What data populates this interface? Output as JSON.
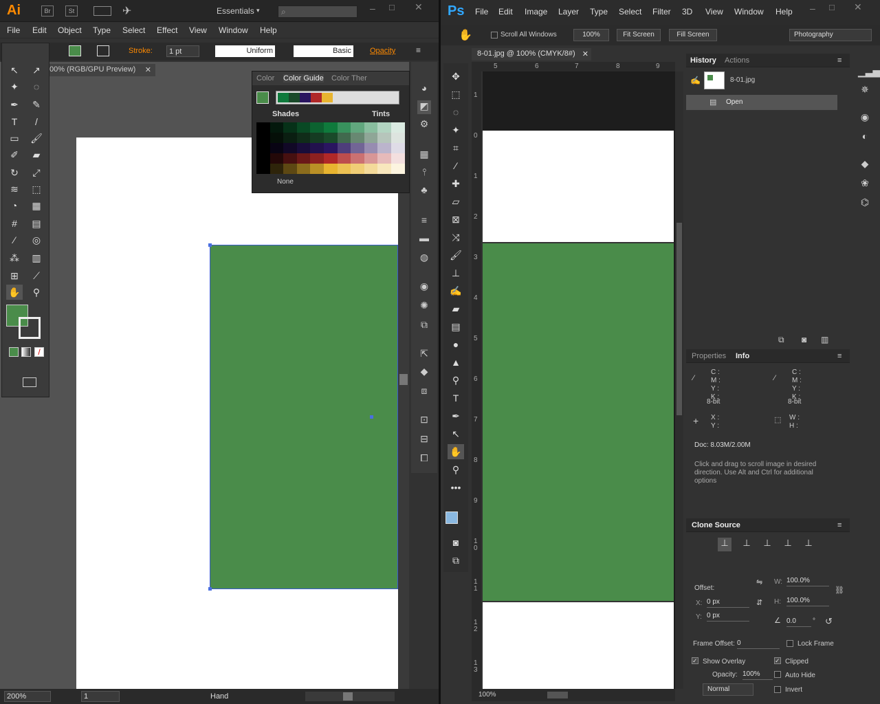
{
  "illustrator": {
    "logo": "Ai",
    "bridge": "Br",
    "stock": "St",
    "workspace": "Essentials",
    "menu": [
      "File",
      "Edit",
      "Object",
      "Type",
      "Select",
      "Effect",
      "View",
      "Window",
      "Help"
    ],
    "control": {
      "stroke_label": "Stroke:",
      "stroke_value": "1 pt",
      "profile": "Uniform",
      "brush": "Basic",
      "opacity_label": "Opacity"
    },
    "doc_tab": "00% (RGB/GPU Preview)",
    "color_panel": {
      "tabs": [
        "Color",
        "Color Guide",
        "Color Ther"
      ],
      "shades_label": "Shades",
      "tints_label": "Tints",
      "none_label": "None",
      "harmony": [
        "#0f7a3c",
        "#1a4a2a",
        "#2a1560",
        "#b02828",
        "#e8b430"
      ]
    },
    "status": {
      "zoom": "200%",
      "page": "1",
      "tool": "Hand"
    },
    "fill_color": "#4a8c4a"
  },
  "photoshop": {
    "logo": "Ps",
    "menu": [
      "File",
      "Edit",
      "Image",
      "Layer",
      "Type",
      "Select",
      "Filter",
      "3D",
      "View",
      "Window",
      "Help"
    ],
    "options": {
      "scroll_all": "Scroll All Windows",
      "zoom": "100%",
      "fit": "Fit Screen",
      "fill": "Fill Screen",
      "workspace": "Photography"
    },
    "doc_tab": "8-01.jpg @ 100% (CMYK/8#)",
    "ruler_top": [
      "5",
      "6",
      "7",
      "8",
      "9"
    ],
    "ruler_left": [
      "1",
      "0",
      "1",
      "2",
      "3",
      "4",
      "5",
      "6",
      "7",
      "8",
      "9",
      "1\n0",
      "1\n1",
      "1\n2",
      "1\n3"
    ],
    "history": {
      "tabs": [
        "History",
        "Actions"
      ],
      "snapshot": "8-01.jpg",
      "state": "Open"
    },
    "info": {
      "tabs": [
        "Properties",
        "Info"
      ],
      "cmyk": [
        "C :",
        "M :",
        "Y :",
        "K :"
      ],
      "bit": "8-bit",
      "xy": [
        "X :",
        "Y :"
      ],
      "wh": [
        "W :",
        "H :"
      ],
      "doc": "Doc: 8.03M/2.00M",
      "hint": "Click and drag to scroll image in desired direction.  Use Alt and Ctrl for additional options"
    },
    "clone": {
      "title": "Clone Source",
      "offset": "Offset:",
      "x_label": "X:",
      "x_val": "0 px",
      "y_label": "Y:",
      "y_val": "0 px",
      "w_label": "W:",
      "w_val": "100.0%",
      "h_label": "H:",
      "h_val": "100.0%",
      "angle": "0.0",
      "deg": "°",
      "frame_offset": "Frame Offset:",
      "frame_val": "0",
      "lock_frame": "Lock Frame",
      "show_overlay": "Show Overlay",
      "clipped": "Clipped",
      "opacity_label": "Opacity:",
      "opacity_val": "100%",
      "auto_hide": "Auto Hide",
      "mode": "Normal",
      "invert": "Invert"
    },
    "status_zoom": "100%",
    "fg_color": "#8ab8e0",
    "bg_color": "#ffffff"
  }
}
